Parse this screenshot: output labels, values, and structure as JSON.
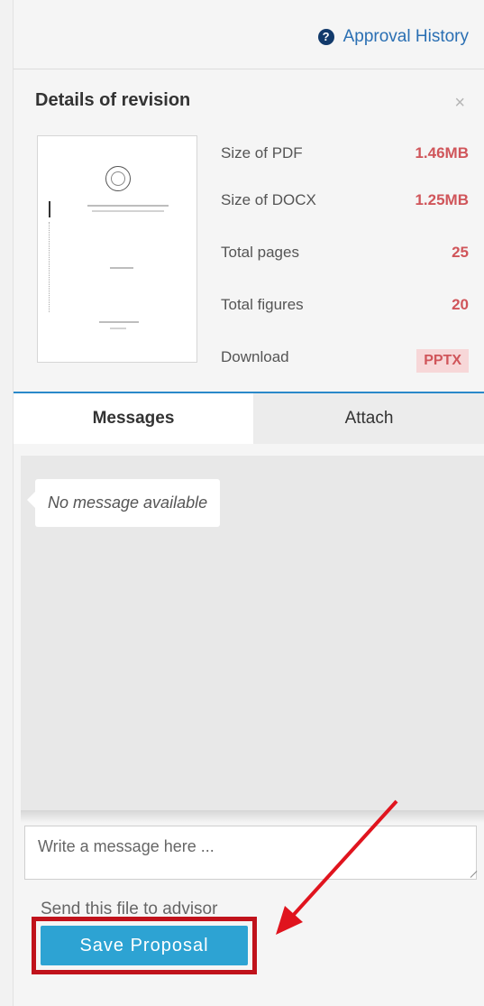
{
  "header": {
    "help_icon_glyph": "?",
    "approval_history_label": "Approval History"
  },
  "details": {
    "title": "Details of revision",
    "close_glyph": "×",
    "stats": [
      {
        "label": "Size of PDF",
        "value": "1.46MB"
      },
      {
        "label": "Size of DOCX",
        "value": "1.25MB"
      },
      {
        "label": "Total pages",
        "value": "25"
      },
      {
        "label": "Total figures",
        "value": "20"
      }
    ],
    "download_label": "Download",
    "download_badge": "PPTX"
  },
  "tabs": {
    "messages_label": "Messages",
    "attach_label": "Attach"
  },
  "messages": {
    "empty_text": "No message available"
  },
  "compose": {
    "placeholder": "Write a message here ..."
  },
  "footer": {
    "send_text": "Send this file to advisor",
    "save_button_label": "Save Proposal"
  },
  "colors": {
    "accent": "#2a89c9",
    "value_red": "#d0555a",
    "highlight_red": "#c0121b",
    "button_blue": "#2da3d3"
  }
}
